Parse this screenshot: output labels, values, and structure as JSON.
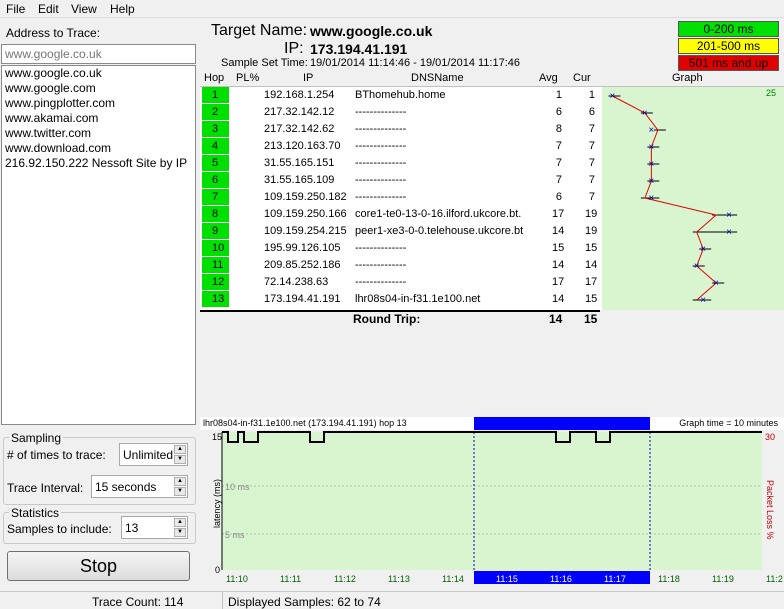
{
  "menu": {
    "items": [
      "File",
      "Edit",
      "View",
      "Help"
    ]
  },
  "left": {
    "address_label": "Address to Trace:",
    "address_placeholder": "www.google.co.uk",
    "history": [
      "www.google.co.uk",
      "www.google.com",
      "www.pingplotter.com",
      "www.akamai.com",
      "www.twitter.com",
      "www.download.com",
      "216.92.150.222 Nessoft Site by IP"
    ],
    "sampling": {
      "legend": "Sampling",
      "times_label": "# of times to trace:",
      "times_value": "Unlimited",
      "interval_label": "Trace Interval:",
      "interval_value": "15 seconds"
    },
    "statistics": {
      "legend": "Statistics",
      "samples_label": "Samples to include:",
      "samples_value": "13"
    },
    "stop_label": "Stop"
  },
  "header": {
    "target_label": "Target Name:",
    "target": "www.google.co.uk",
    "ip_label": "IP:",
    "ip": "173.194.41.191",
    "sample_time_label": "Sample Set Time:",
    "sample_time": "19/01/2014 11:14:46 - 19/01/2014 11:17:46"
  },
  "legend": [
    {
      "label": "0-200 ms",
      "color": "#00e000"
    },
    {
      "label": "201-500 ms",
      "color": "#ffff00"
    },
    {
      "label": "501 ms and up",
      "color": "#e00000"
    }
  ],
  "table": {
    "columns": [
      "Hop",
      "PL%",
      "IP",
      "DNSName",
      "Avg",
      "Cur",
      "Graph"
    ],
    "graph_scale_label": "25",
    "rows": [
      {
        "hop": "1",
        "ip": "192.168.1.254",
        "dns": "BThomehub.home",
        "avg": "1",
        "cur": "1"
      },
      {
        "hop": "2",
        "ip": "217.32.142.12",
        "dns": "--------------",
        "avg": "6",
        "cur": "6"
      },
      {
        "hop": "3",
        "ip": "217.32.142.62",
        "dns": "--------------",
        "avg": "8",
        "cur": "7"
      },
      {
        "hop": "4",
        "ip": "213.120.163.70",
        "dns": "--------------",
        "avg": "7",
        "cur": "7"
      },
      {
        "hop": "5",
        "ip": "31.55.165.151",
        "dns": "--------------",
        "avg": "7",
        "cur": "7"
      },
      {
        "hop": "6",
        "ip": "31.55.165.109",
        "dns": "--------------",
        "avg": "7",
        "cur": "7"
      },
      {
        "hop": "7",
        "ip": "109.159.250.182",
        "dns": "--------------",
        "avg": "6",
        "cur": "7"
      },
      {
        "hop": "8",
        "ip": "109.159.250.166",
        "dns": "core1-te0-13-0-16.ilford.ukcore.bt.",
        "avg": "17",
        "cur": "19"
      },
      {
        "hop": "9",
        "ip": "109.159.254.215",
        "dns": "peer1-xe3-0-0.telehouse.ukcore.bt",
        "avg": "14",
        "cur": "19"
      },
      {
        "hop": "10",
        "ip": "195.99.126.105",
        "dns": "--------------",
        "avg": "15",
        "cur": "15"
      },
      {
        "hop": "11",
        "ip": "209.85.252.186",
        "dns": "--------------",
        "avg": "14",
        "cur": "14"
      },
      {
        "hop": "12",
        "ip": "72.14.238.63",
        "dns": "--------------",
        "avg": "17",
        "cur": "17"
      },
      {
        "hop": "13",
        "ip": "173.194.41.191",
        "dns": "lhr08s04-in-f31.1e100.net",
        "avg": "14",
        "cur": "15"
      }
    ],
    "round_trip_label": "Round Trip:",
    "round_trip_avg": "14",
    "round_trip_cur": "15"
  },
  "timegraph": {
    "title": "lhr08s04-in-f31.1e100.net (173.194.41.191) hop 13",
    "graph_time": "Graph time = 10 minutes",
    "y_axis_label": "latency (ms)",
    "y_ticks": [
      "15",
      "10 ms",
      "5 ms",
      "0"
    ],
    "right_axis_label": "Packet Loss %",
    "right_tick": "30",
    "time_labels": [
      "11:10",
      "11:11",
      "11:12",
      "11:13",
      "11:14",
      "11:15",
      "11:16",
      "11:17",
      "11:18",
      "11:19",
      "11:2"
    ]
  },
  "status": {
    "trace_count": "Trace Count: 114",
    "displayed": "Displayed Samples: 62 to 74"
  }
}
